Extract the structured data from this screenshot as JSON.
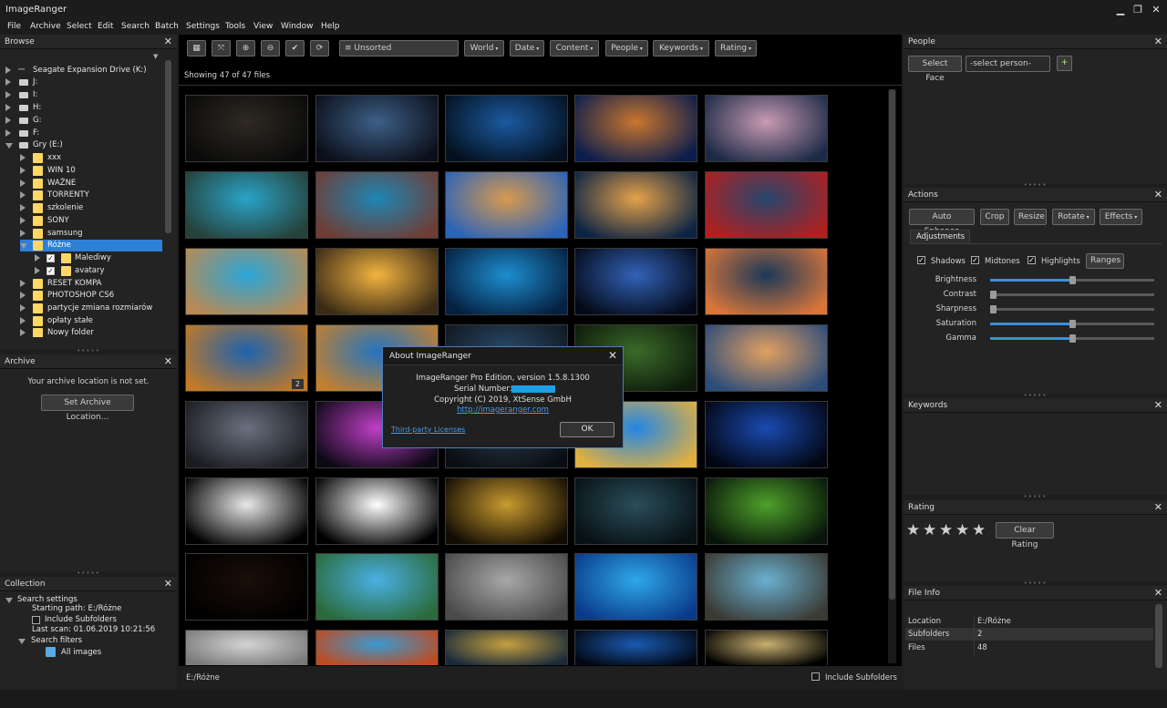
{
  "app": {
    "title": "ImageRanger"
  },
  "menu": [
    "File",
    "Archive",
    "Select",
    "Edit",
    "Search",
    "Batch",
    "Settings",
    "Tools",
    "View",
    "Window",
    "Help"
  ],
  "browse": {
    "title": "Browse",
    "items": [
      {
        "label": "Seagate Expansion Drive (K:)"
      },
      {
        "label": "J:"
      },
      {
        "label": "I:"
      },
      {
        "label": "H:"
      },
      {
        "label": "G:"
      },
      {
        "label": "F:"
      },
      {
        "label": "Gry (E:)"
      },
      {
        "label": "xxx"
      },
      {
        "label": "WIN 10"
      },
      {
        "label": "WAŻNE"
      },
      {
        "label": "TORRENTY"
      },
      {
        "label": "szkolenie"
      },
      {
        "label": "SONY"
      },
      {
        "label": "samsung"
      },
      {
        "label": "Różne"
      },
      {
        "label": "Malediwy"
      },
      {
        "label": "avatary"
      },
      {
        "label": "RESET KOMPA"
      },
      {
        "label": "PHOTOSHOP CS6"
      },
      {
        "label": "partycje zmiana rozmiarów"
      },
      {
        "label": "opłaty stałe"
      },
      {
        "label": "Nowy folder"
      }
    ]
  },
  "archive": {
    "title": "Archive",
    "message": "Your archive location is not set.",
    "button": "Set Archive Location..."
  },
  "collection": {
    "title": "Collection",
    "search_settings": "Search settings",
    "starting_path": "Starting path: E:/Różne",
    "include_subfolders": "Include Subfolders",
    "last_scan": "Last scan: 01.06.2019 10:21:56",
    "search_filters": "Search filters",
    "all_images": "All images"
  },
  "toolbar": {
    "sort_value": "Unsorted",
    "filters": [
      "World",
      "Date",
      "Content",
      "People",
      "Keywords",
      "Rating"
    ]
  },
  "viewer": {
    "showing": "Showing 47 of 47 files",
    "badge": "2",
    "path": "E:/Różne",
    "include_subfolders": "Include Subfolders"
  },
  "about": {
    "title": "About ImageRanger",
    "line1": "ImageRanger Pro Edition, version 1.5.8.1300",
    "serial_label": "Serial Number:",
    "copyright": "Copyright (C) 2019, XtSense GmbH",
    "url": "http://imageranger.com",
    "licenses": "Third-party Licenses",
    "ok": "OK"
  },
  "people": {
    "title": "People",
    "select_face": "Select Face",
    "select_person": "-select person-",
    "add": "+"
  },
  "actions": {
    "title": "Actions",
    "buttons": [
      "Auto Enhance",
      "Crop",
      "Resize",
      "Rotate",
      "Effects"
    ],
    "tab": "Adjustments",
    "shadows": "Shadows",
    "midtones": "Midtones",
    "highlights": "Highlights",
    "ranges": "Ranges",
    "sliders": [
      {
        "label": "Brightness",
        "value": 0.5
      },
      {
        "label": "Contrast",
        "value": 0.0
      },
      {
        "label": "Sharpness",
        "value": 0.0
      },
      {
        "label": "Saturation",
        "value": 0.5
      },
      {
        "label": "Gamma",
        "value": 0.5
      }
    ]
  },
  "keywords": {
    "title": "Keywords"
  },
  "rating": {
    "title": "Rating",
    "stars": 5,
    "clear": "Clear Rating"
  },
  "fileinfo": {
    "title": "File Info",
    "rows": [
      {
        "key": "Location",
        "value": "E:/Różne"
      },
      {
        "key": "Subfolders",
        "value": "2"
      },
      {
        "key": "Files",
        "value": "48"
      }
    ]
  },
  "thumbnails": [
    {
      "c1": "#2e2a22",
      "c2": "#0a0a0a"
    },
    {
      "c1": "#3d5f86",
      "c2": "#0b0f1a"
    },
    {
      "c1": "#1b5aa0",
      "c2": "#04101e"
    },
    {
      "c1": "#c9762e",
      "c2": "#0b1d4c"
    },
    {
      "c1": "#c89ab2",
      "c2": "#1c2a46"
    },
    {
      "c1": "#29a4c8",
      "c2": "#26413a"
    },
    {
      "c1": "#1e86b4",
      "c2": "#6e3d34"
    },
    {
      "c1": "#d89a4e",
      "c2": "#2a63b8"
    },
    {
      "c1": "#e4a24a",
      "c2": "#0c2344"
    },
    {
      "c1": "#26466e",
      "c2": "#b02020"
    },
    {
      "c1": "#2aa6d8",
      "c2": "#b88a54"
    },
    {
      "c1": "#f2b440",
      "c2": "#3a2a16"
    },
    {
      "c1": "#1d8ed0",
      "c2": "#052040"
    },
    {
      "c1": "#3262b8",
      "c2": "#040a18"
    },
    {
      "c1": "#1a3858",
      "c2": "#d8763a"
    },
    {
      "c1": "#1e62ae",
      "c2": "#c07a28"
    },
    {
      "c1": "#2474c0",
      "c2": "#c08030"
    },
    {
      "c1": "#2a4a6a",
      "c2": "#101820"
    },
    {
      "c1": "#3a6a2a",
      "c2": "#0d1a0a"
    },
    {
      "c1": "#e2a060",
      "c2": "#2c4c7a"
    },
    {
      "c1": "#6a7080",
      "c2": "#1a1c20"
    },
    {
      "c1": "#c040c8",
      "c2": "#0c0814"
    },
    {
      "c1": "#2a3a4a",
      "c2": "#0a0e14"
    },
    {
      "c1": "#2486e4",
      "c2": "#e0b040"
    },
    {
      "c1": "#1a4ab0",
      "c2": "#020612"
    },
    {
      "c1": "#e8e8e8",
      "c2": "#000000"
    },
    {
      "c1": "#ffffff",
      "c2": "#000000"
    },
    {
      "c1": "#c89a30",
      "c2": "#120c02"
    },
    {
      "c1": "#2a4e5a",
      "c2": "#071014"
    },
    {
      "c1": "#4ea02a",
      "c2": "#08140a"
    },
    {
      "c1": "#1a0e08",
      "c2": "#000000"
    },
    {
      "c1": "#4ab0e4",
      "c2": "#2a6a3a"
    },
    {
      "c1": "#a8a8a8",
      "c2": "#4a4a4a"
    },
    {
      "c1": "#2ea8e8",
      "c2": "#0a3a8a"
    },
    {
      "c1": "#6ab0d0",
      "c2": "#3a3a34"
    },
    {
      "c1": "#d4d4d4",
      "c2": "#7a7a7a"
    },
    {
      "c1": "#3a9ad0",
      "c2": "#c04a20"
    },
    {
      "c1": "#c4a040",
      "c2": "#1a2a3a"
    },
    {
      "c1": "#1a5ab0",
      "c2": "#020814"
    },
    {
      "c1": "#c8b070",
      "c2": "#000000"
    }
  ]
}
